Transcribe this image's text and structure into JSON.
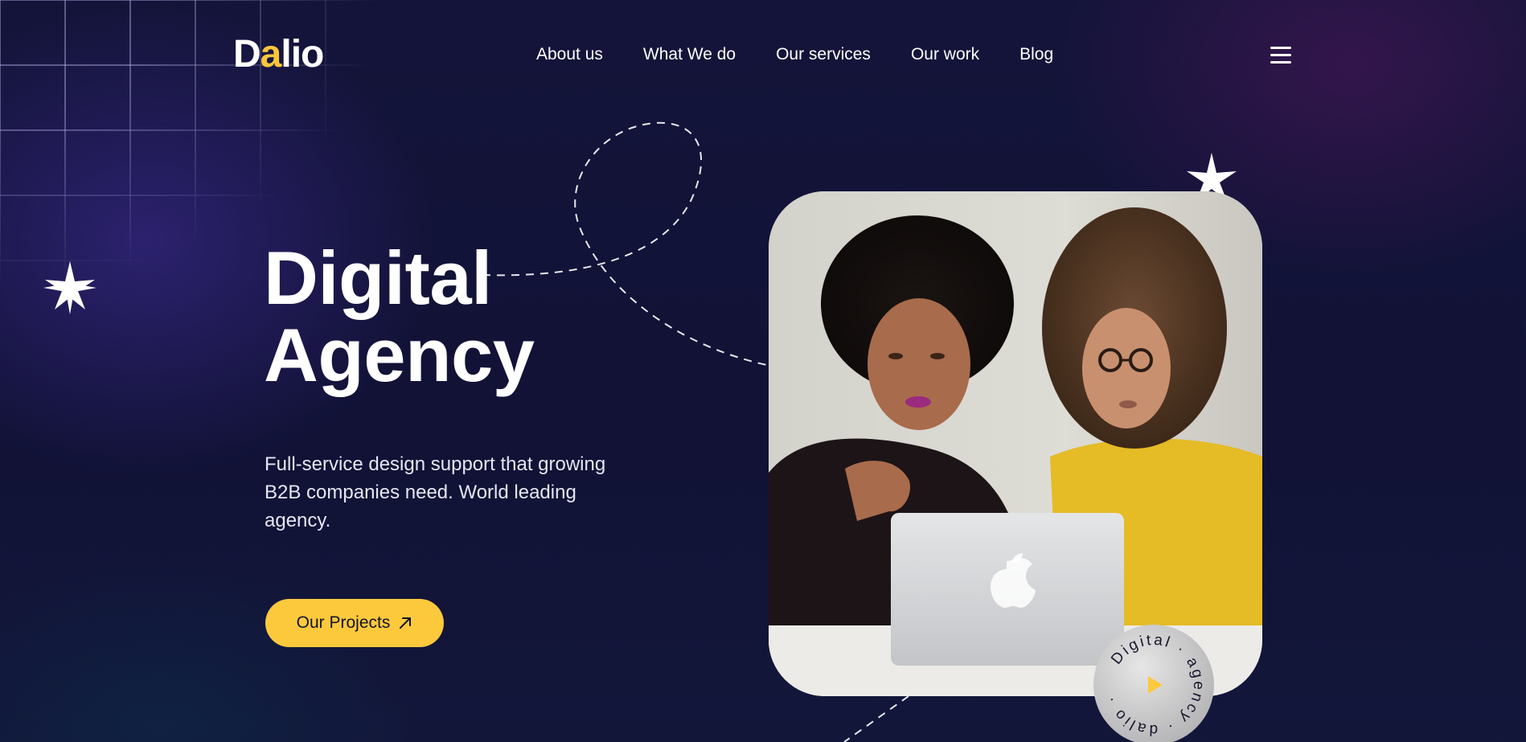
{
  "brand": {
    "logo_prefix": "D",
    "logo_accent": "a",
    "logo_suffix": "lio",
    "accent_color": "#fcc93d"
  },
  "nav": {
    "items": [
      {
        "label": "About us"
      },
      {
        "label": "What We do"
      },
      {
        "label": "Our services"
      },
      {
        "label": "Our work"
      },
      {
        "label": "Blog"
      }
    ],
    "menu_icon": "hamburger-menu-icon"
  },
  "hero": {
    "title_line1": "Digital",
    "title_line2": "Agency",
    "description": "Full-service design support that growing B2B companies need. World leading agency.",
    "cta_label": "Our Projects",
    "cta_icon": "arrow-up-right-icon"
  },
  "badge": {
    "text": "Digital · agency · dalio ·",
    "icon": "play-icon"
  },
  "image": {
    "description_icon": "team-photo"
  }
}
